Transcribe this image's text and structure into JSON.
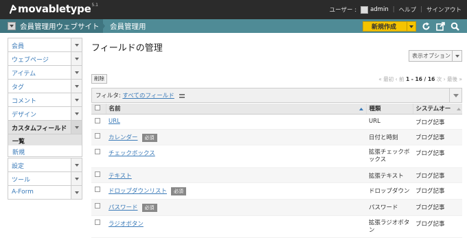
{
  "header": {
    "logo": "movabletype",
    "logo_version": "5.1",
    "user_label": "ユーザー :",
    "username": "admin",
    "help": "ヘルプ",
    "signout": "サインアウト"
  },
  "blogbar": {
    "site_name": "会員管理用ウェブサイト",
    "blog_name": "会員管理用",
    "new_button": "新規作成"
  },
  "sidebar": {
    "items": [
      {
        "label": "会員"
      },
      {
        "label": "ウェブページ"
      },
      {
        "label": "アイテム"
      },
      {
        "label": "タグ"
      },
      {
        "label": "コメント"
      },
      {
        "label": "デザイン"
      },
      {
        "label": "カスタムフィールド"
      },
      {
        "label": "設定"
      },
      {
        "label": "ツール"
      },
      {
        "label": "A-Form"
      }
    ],
    "sub": [
      "一覧",
      "新規"
    ]
  },
  "main": {
    "title": "フィールドの管理",
    "display_options": "表示オプション",
    "delete_button": "削除",
    "pager": {
      "first": "« 最初",
      "prev": "‹ 前",
      "range": "1 - 16 / 16",
      "next": "次 ›",
      "last": "最後 »"
    },
    "filter_label": "フィルタ:",
    "filter_value": "すべてのフィールド",
    "columns": [
      "名前",
      "種類",
      "システムオー"
    ],
    "required_badge": "必須",
    "rows": [
      {
        "name": "URL",
        "required": false,
        "type": "URL",
        "system": "ブログ記事"
      },
      {
        "name": "カレンダー",
        "required": true,
        "type": "日付と時刻",
        "system": "ブログ記事"
      },
      {
        "name": "チェックボックス",
        "required": false,
        "type": "拡張チェックボックス",
        "system": "ブログ記事"
      },
      {
        "name": "テキスト",
        "required": false,
        "type": "拡張テキスト",
        "system": "ブログ記事"
      },
      {
        "name": "ドロップダウンリスト",
        "required": true,
        "type": "ドロップダウン",
        "system": "ブログ記事"
      },
      {
        "name": "パスワード",
        "required": true,
        "type": "パスワード",
        "system": "ブログ記事"
      },
      {
        "name": "ラジオボタン",
        "required": false,
        "type": "拡張ラジオボタン",
        "system": "ブログ記事"
      }
    ]
  }
}
